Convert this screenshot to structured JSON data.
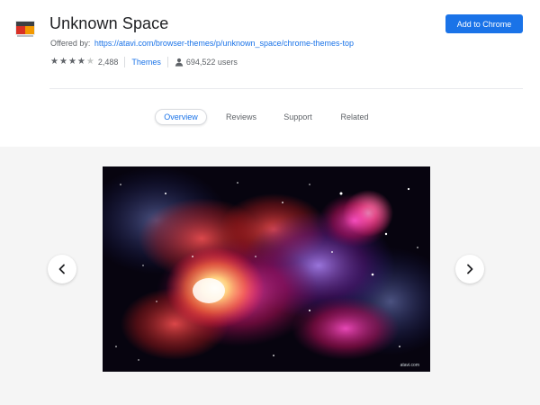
{
  "app": {
    "title": "Unknown Space",
    "offered_by_label": "Offered by:",
    "offered_by_url": "https://atavi.com/browser-themes/p/unknown_space/chrome-themes-top",
    "rating": 4,
    "rating_max": 5,
    "rating_count": "2,488",
    "category": "Themes",
    "users": "694,522 users",
    "icon_name": "theme-icon",
    "users_icon_name": "person-icon"
  },
  "actions": {
    "add_label": "Add to Chrome"
  },
  "tabs": [
    {
      "label": "Overview",
      "active": true
    },
    {
      "label": "Reviews",
      "active": false
    },
    {
      "label": "Support",
      "active": false
    },
    {
      "label": "Related",
      "active": false
    }
  ],
  "gallery": {
    "prev_icon": "chevron-left-icon",
    "next_icon": "chevron-right-icon",
    "watermark": "atavi.com"
  },
  "colors": {
    "accent": "#1a73e8",
    "muted_text": "#5f6368",
    "gallery_bg": "#f5f5f5"
  }
}
